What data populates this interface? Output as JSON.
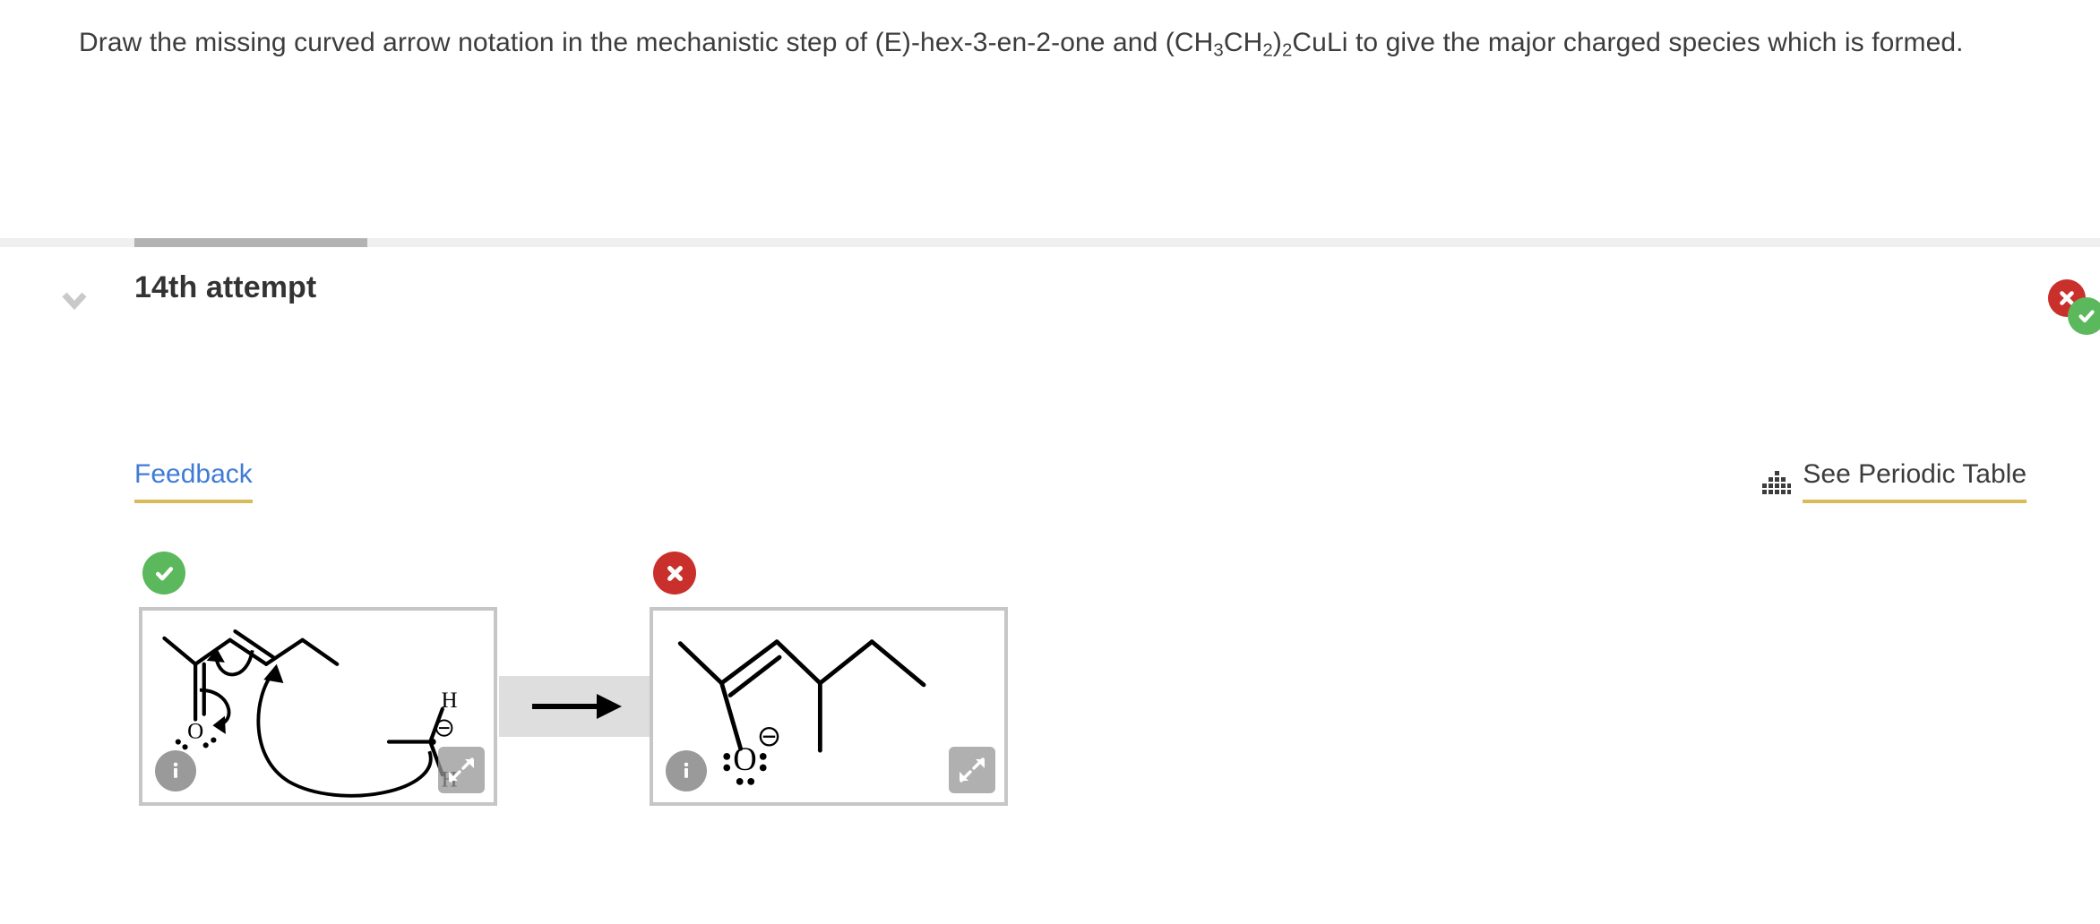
{
  "question": {
    "line1_a": "Draw the missing curved arrow notation in the mechanistic step of (E)-hex-3-en-2-one and (CH",
    "sub1": "3",
    "line1_b": "CH",
    "sub2": "2",
    "line1_c": ")",
    "sub3": "2",
    "line1_d": "CuLi to give the major charged species which is",
    "line2": "formed.",
    "full_text": "Draw the missing curved arrow notation in the mechanistic step of (E)-hex-3-en-2-one and (CH3CH2)2CuLi to give the major charged species which is formed."
  },
  "attempt": {
    "title": "14th attempt",
    "toggle_icon": "chevron-down-icon",
    "progress_percent": 11
  },
  "overall_status": {
    "incorrect_icon": "x-circle-icon",
    "correct_icon": "check-circle-icon",
    "incorrect_color": "#c9302c",
    "correct_color": "#5cb85c"
  },
  "links": {
    "feedback_label": "Feedback",
    "feedback_color": "#3f7bd6",
    "underline_color": "#d9bb5c",
    "periodic_table_label": "See Periodic Table",
    "periodic_table_icon": "periodic-table-grid-icon"
  },
  "answer": {
    "reaction_arrow_icon": "reaction-arrow-icon",
    "panels": [
      {
        "id": "reactant-panel",
        "status": "correct",
        "status_icon": "check-circle-icon",
        "status_color": "#5cb85c",
        "info_icon": "info-icon",
        "expand_icon": "expand-arrows-icon",
        "description": "Mechanism step: (E)-hex-3-en-2-one with curved arrows and ethyl carbanion",
        "atom_labels": [
          "O",
          "H",
          "H"
        ],
        "charge_labels": [
          "⊖"
        ]
      },
      {
        "id": "product-panel",
        "status": "incorrect",
        "status_icon": "x-circle-icon",
        "status_color": "#c9302c",
        "info_icon": "info-icon",
        "expand_icon": "expand-arrows-icon",
        "description": "Enolate product with negatively charged oxygen",
        "atom_labels": [
          "O"
        ],
        "charge_labels": [
          "⊖"
        ]
      }
    ]
  }
}
